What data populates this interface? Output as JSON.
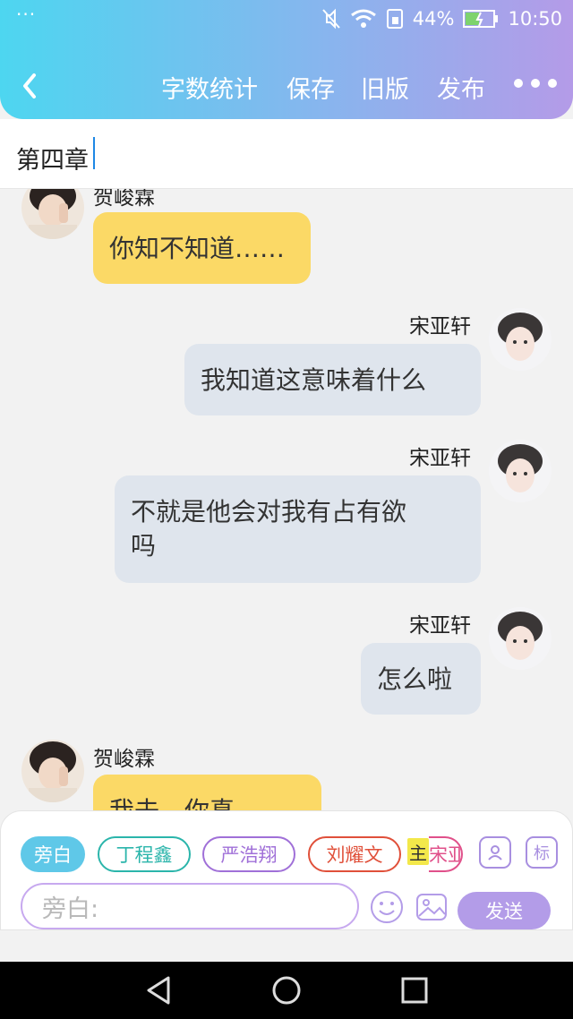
{
  "status_bar": {
    "dots": "···",
    "battery_pct": "44%",
    "time": "10:50"
  },
  "toolbar": {
    "word_count": "字数统计",
    "save": "保存",
    "old_version": "旧版",
    "publish": "发布"
  },
  "chapter": {
    "title": "第四章"
  },
  "messages": [
    {
      "speaker": "贺峻霖",
      "text": "你知不知道……",
      "side": "left"
    },
    {
      "speaker": "宋亚轩",
      "text": "我知道这意味着什么",
      "side": "right"
    },
    {
      "speaker": "宋亚轩",
      "text": "不就是他会对我有占有欲吗",
      "line1": "不就是他会对我有占有欲",
      "line2": "吗",
      "side": "right"
    },
    {
      "speaker": "宋亚轩",
      "text": "怎么啦",
      "side": "right"
    },
    {
      "speaker": "贺峻霖",
      "text": "我去…你真…",
      "side": "left"
    }
  ],
  "roles": [
    {
      "label": "旁白",
      "color": "#5fc8e8"
    },
    {
      "label": "丁程鑫",
      "color": "#2bb5ab"
    },
    {
      "label": "严浩翔",
      "color": "#a070d8"
    },
    {
      "label": "刘耀文",
      "color": "#e0503a"
    },
    {
      "label": "主",
      "color": "#f3e84a"
    },
    {
      "label": "宋亚",
      "color": "#e0508a"
    }
  ],
  "icons": {
    "contact_btn": "contact-card-icon",
    "tag_btn_label": "标"
  },
  "input": {
    "placeholder": "旁白:"
  },
  "send_label": "发送"
}
